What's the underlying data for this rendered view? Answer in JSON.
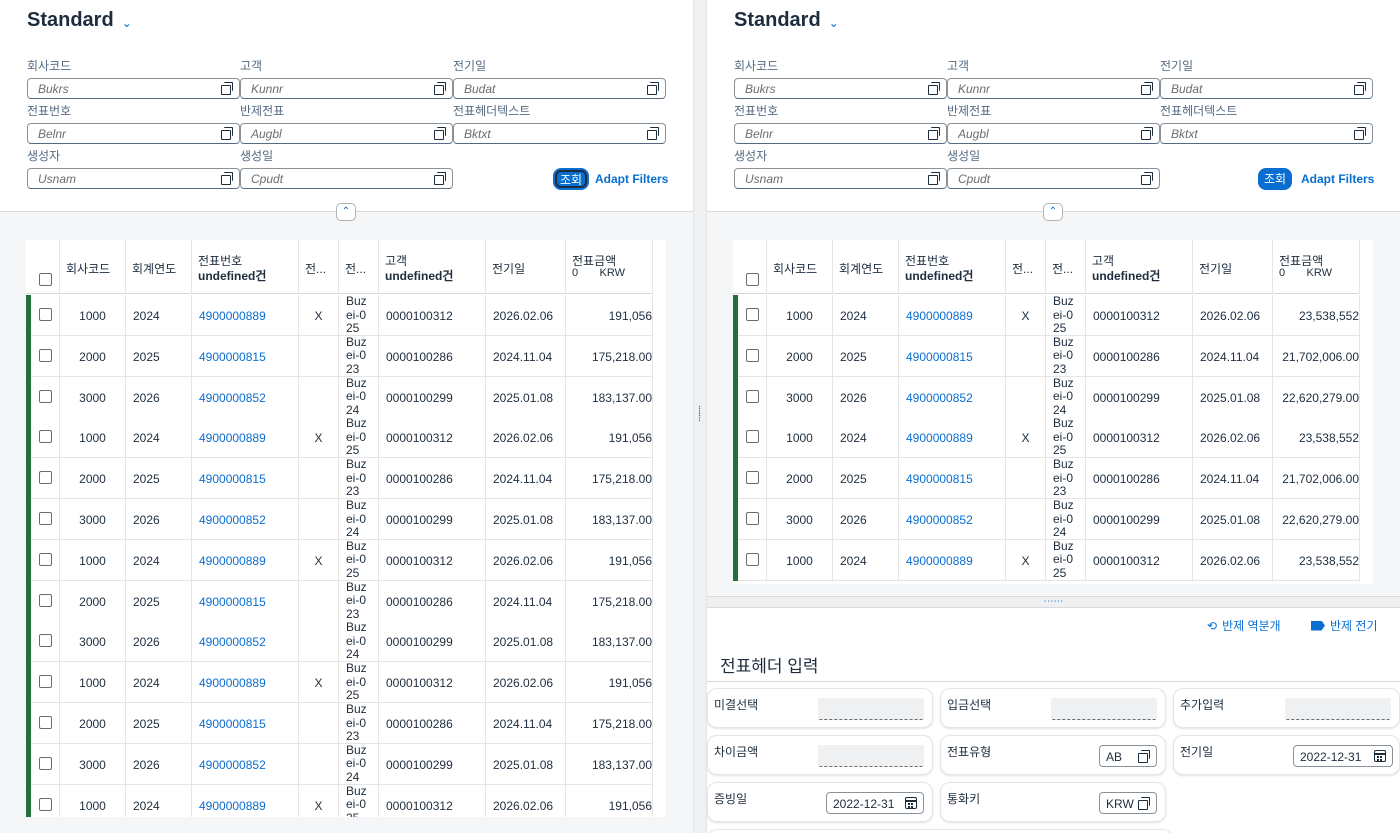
{
  "view_title": "Standard",
  "filters": {
    "labels": [
      "회사코드",
      "고객",
      "전기일",
      "전표번호",
      "반제전표",
      "전표헤더텍스트",
      "생성자",
      "생성일"
    ],
    "placeholders": [
      "Bukrs",
      "Kunnr",
      "Budat",
      "Belnr",
      "Augbl",
      "Bktxt",
      "Usnam",
      "Cpudt"
    ],
    "go_label": "조회",
    "adapt_label": "Adapt Filters"
  },
  "table": {
    "columns": [
      {
        "label": "회사코드",
        "sub": ""
      },
      {
        "label": "회계연도",
        "sub": ""
      },
      {
        "label": "전표번호",
        "sub": "undefined건"
      },
      {
        "label": "전...",
        "sub": ""
      },
      {
        "label": "전...",
        "sub": ""
      },
      {
        "label": "고객",
        "sub": "undefined건"
      },
      {
        "label": "전기일",
        "sub": ""
      },
      {
        "label": "전표금액",
        "sub": "0       KRW"
      }
    ]
  },
  "left_rows": [
    [
      "1000",
      "2024",
      "4900000889",
      "X",
      "Buzei-025",
      "0000100312",
      "2026.02.06",
      "191,056"
    ],
    [
      "2000",
      "2025",
      "4900000815",
      "",
      "Buzei-023",
      "0000100286",
      "2024.11.04",
      "175,218.00"
    ],
    [
      "3000",
      "2026",
      "4900000852",
      "",
      "Buzei-024",
      "0000100299",
      "2025.01.08",
      "183,137.00"
    ],
    [
      "1000",
      "2024",
      "4900000889",
      "X",
      "Buzei-025",
      "0000100312",
      "2026.02.06",
      "191,056"
    ],
    [
      "2000",
      "2025",
      "4900000815",
      "",
      "Buzei-023",
      "0000100286",
      "2024.11.04",
      "175,218.00"
    ],
    [
      "3000",
      "2026",
      "4900000852",
      "",
      "Buzei-024",
      "0000100299",
      "2025.01.08",
      "183,137.00"
    ],
    [
      "1000",
      "2024",
      "4900000889",
      "X",
      "Buzei-025",
      "0000100312",
      "2026.02.06",
      "191,056"
    ],
    [
      "2000",
      "2025",
      "4900000815",
      "",
      "Buzei-023",
      "0000100286",
      "2024.11.04",
      "175,218.00"
    ],
    [
      "3000",
      "2026",
      "4900000852",
      "",
      "Buzei-024",
      "0000100299",
      "2025.01.08",
      "183,137.00"
    ],
    [
      "1000",
      "2024",
      "4900000889",
      "X",
      "Buzei-025",
      "0000100312",
      "2026.02.06",
      "191,056"
    ],
    [
      "2000",
      "2025",
      "4900000815",
      "",
      "Buzei-023",
      "0000100286",
      "2024.11.04",
      "175,218.00"
    ],
    [
      "3000",
      "2026",
      "4900000852",
      "",
      "Buzei-024",
      "0000100299",
      "2025.01.08",
      "183,137.00"
    ],
    [
      "1000",
      "2024",
      "4900000889",
      "X",
      "Buzei-025",
      "0000100312",
      "2026.02.06",
      "191,056"
    ]
  ],
  "right_rows": [
    [
      "1000",
      "2024",
      "4900000889",
      "X",
      "Buzei-025",
      "0000100312",
      "2026.02.06",
      "23,538,552"
    ],
    [
      "2000",
      "2025",
      "4900000815",
      "",
      "Buzei-023",
      "0000100286",
      "2024.11.04",
      "21,702,006.00"
    ],
    [
      "3000",
      "2026",
      "4900000852",
      "",
      "Buzei-024",
      "0000100299",
      "2025.01.08",
      "22,620,279.00"
    ],
    [
      "1000",
      "2024",
      "4900000889",
      "X",
      "Buzei-025",
      "0000100312",
      "2026.02.06",
      "23,538,552"
    ],
    [
      "2000",
      "2025",
      "4900000815",
      "",
      "Buzei-023",
      "0000100286",
      "2024.11.04",
      "21,702,006.00"
    ],
    [
      "3000",
      "2026",
      "4900000852",
      "",
      "Buzei-024",
      "0000100299",
      "2025.01.08",
      "22,620,279.00"
    ],
    [
      "1000",
      "2024",
      "4900000889",
      "X",
      "Buzei-025",
      "0000100312",
      "2026.02.06",
      "23,538,552"
    ]
  ],
  "form": {
    "reverse_label": "반제 역분개",
    "post_label": "반제 전기",
    "title": "전표헤더 입력",
    "fields": {
      "unsettled": "미결선택",
      "payment": "입금선택",
      "additional": "추가입력",
      "difference": "차이금액",
      "doc_type": "전표유형",
      "doc_type_value": "AB",
      "posting_date": "전기일",
      "posting_date_value": "2022-12-31",
      "doc_date": "증빙일",
      "doc_date_value": "2022-12-31",
      "currency": "통화키",
      "currency_value": "KRW"
    }
  }
}
